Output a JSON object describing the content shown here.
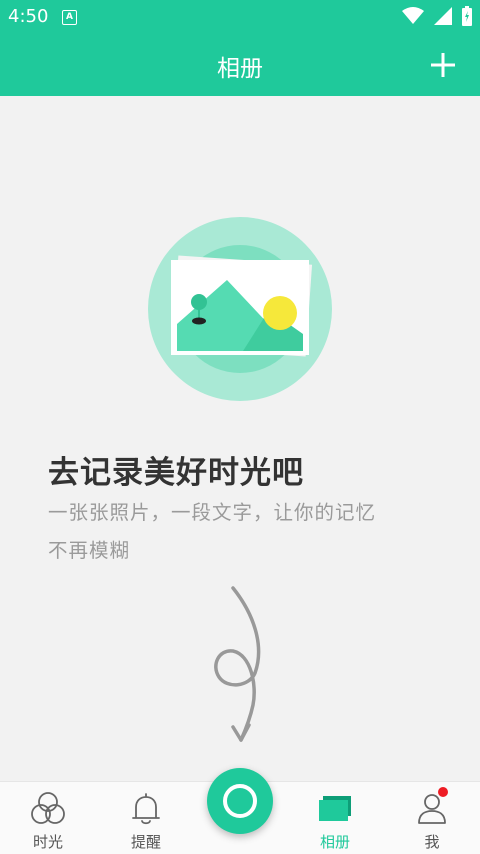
{
  "status_bar": {
    "time": "4:50",
    "notification_icon": "a-icon",
    "icons": [
      "wifi-icon",
      "signal-icon",
      "battery-icon"
    ]
  },
  "app_bar": {
    "title": "相册",
    "add_icon": "plus-icon"
  },
  "empty_state": {
    "heading": "去记录美好时光吧",
    "subtitle_line1": "一张张照片，一段文字，让你的记忆",
    "subtitle_line2": "不再模糊"
  },
  "bottom_nav": {
    "items": [
      {
        "label": "时光",
        "icon": "circles-icon",
        "active": false
      },
      {
        "label": "提醒",
        "icon": "bell-icon",
        "active": false
      },
      {
        "label": "",
        "icon": "record-button-icon",
        "active": false
      },
      {
        "label": "相册",
        "icon": "album-icon",
        "active": true
      },
      {
        "label": "我",
        "icon": "person-icon",
        "active": false,
        "badge": true
      }
    ]
  },
  "colors": {
    "primary": "#1fc99b",
    "background": "#f2f2f2",
    "badge": "#ee1c24"
  }
}
